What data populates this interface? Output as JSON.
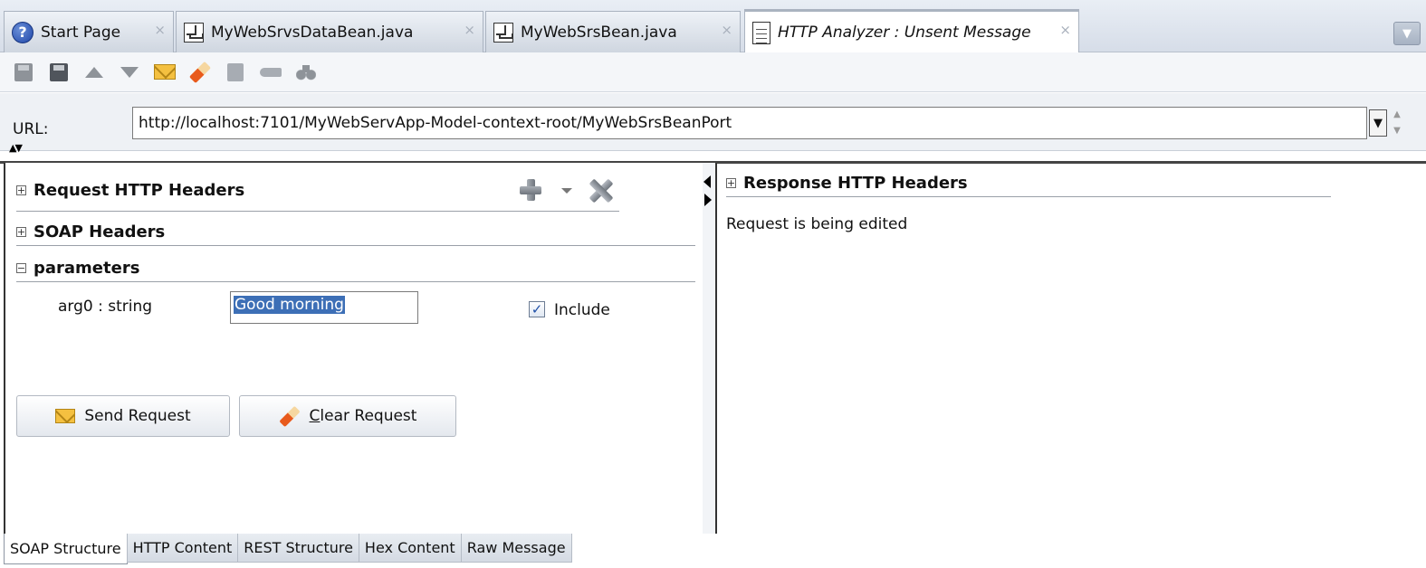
{
  "tabs": [
    {
      "label": "Start Page",
      "icon": "help-icon",
      "active": false
    },
    {
      "label": "MyWebSrvsDataBean.java",
      "icon": "java-file-icon",
      "active": false
    },
    {
      "label": "MyWebSrsBean.java",
      "icon": "java-file-icon",
      "active": false
    },
    {
      "label": "HTTP Analyzer : Unsent Message",
      "icon": "document-icon",
      "active": true
    }
  ],
  "tab_close_glyph": "×",
  "toolbar_icons": [
    "save-icon",
    "save-to-file-icon",
    "previous-icon",
    "next-icon",
    "send-request-icon",
    "clear-request-icon",
    "find-icon",
    "key-icon",
    "binoculars-icon"
  ],
  "url": {
    "label": "URL:",
    "value": "http://localhost:7101/MyWebServApp-Model-context-root/MyWebSrsBeanPort"
  },
  "request": {
    "http_headers": "Request HTTP Headers",
    "soap_headers": "SOAP Headers",
    "parameters": "parameters",
    "param_name": "arg0 : string",
    "param_value": "Good morning",
    "include_label": "Include",
    "include_checked": true,
    "send_button": "Send Request",
    "clear_button_accel": "C",
    "clear_button_rest": "lear Request"
  },
  "response": {
    "http_headers": "Response HTTP Headers",
    "status_text": "Request is being edited"
  },
  "bottom_tabs": [
    "SOAP Structure",
    "HTTP Content",
    "REST Structure",
    "Hex Content",
    "Raw Message"
  ],
  "colors": {
    "active_tab_accent": "#f0c050",
    "selection": "#3d6fb6",
    "envelope": "#f4c040",
    "eraser": "#e85a1c"
  }
}
